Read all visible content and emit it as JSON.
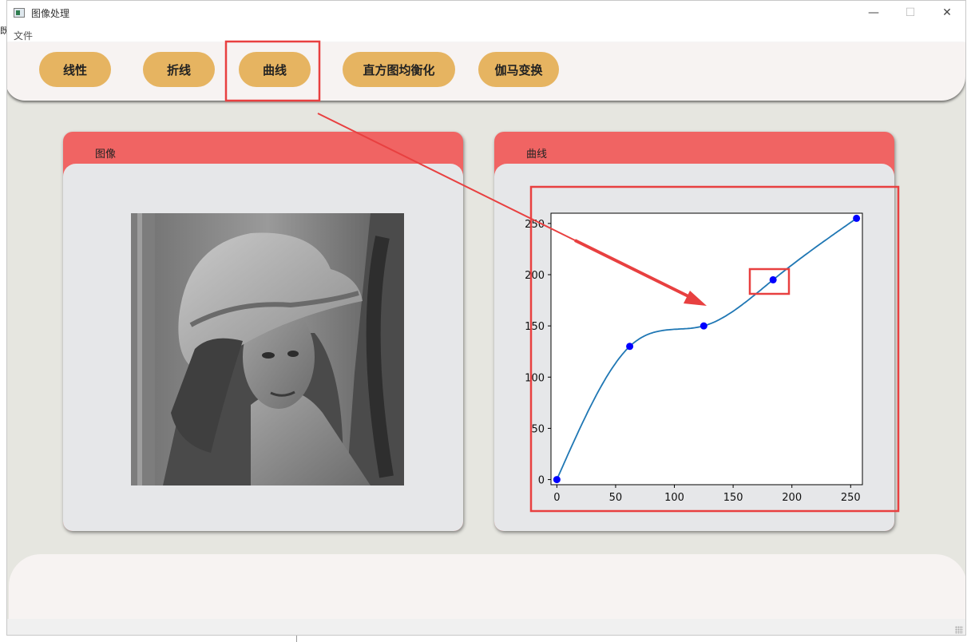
{
  "window": {
    "title": "图像处理"
  },
  "controls": {
    "minimize": "—",
    "maximize": "☐",
    "close": "✕"
  },
  "menu": {
    "file": "文件"
  },
  "background_fragment": "既",
  "toolbar": {
    "buttons": [
      {
        "label": "线性"
      },
      {
        "label": "折线"
      },
      {
        "label": "曲线"
      },
      {
        "label": "直方图均衡化"
      },
      {
        "label": "伽马变换"
      }
    ]
  },
  "left_panel": {
    "title": "图像"
  },
  "right_panel": {
    "title": "曲线"
  },
  "colors": {
    "button": "#e6b461",
    "panel_header": "#f06463",
    "panel_body": "#e6e7e9",
    "annotation": "#e84040",
    "curve": "#1f77b4",
    "points": "#0000ff"
  },
  "chart_data": {
    "type": "line",
    "x_ticks": [
      0,
      50,
      100,
      150,
      200,
      250
    ],
    "y_ticks": [
      0,
      50,
      100,
      150,
      200,
      250
    ],
    "xlim": [
      -5,
      260
    ],
    "ylim": [
      -5,
      260
    ],
    "control_points": [
      {
        "x": 0,
        "y": 0
      },
      {
        "x": 62,
        "y": 130
      },
      {
        "x": 125,
        "y": 150
      },
      {
        "x": 184,
        "y": 195
      },
      {
        "x": 255,
        "y": 255
      }
    ]
  }
}
